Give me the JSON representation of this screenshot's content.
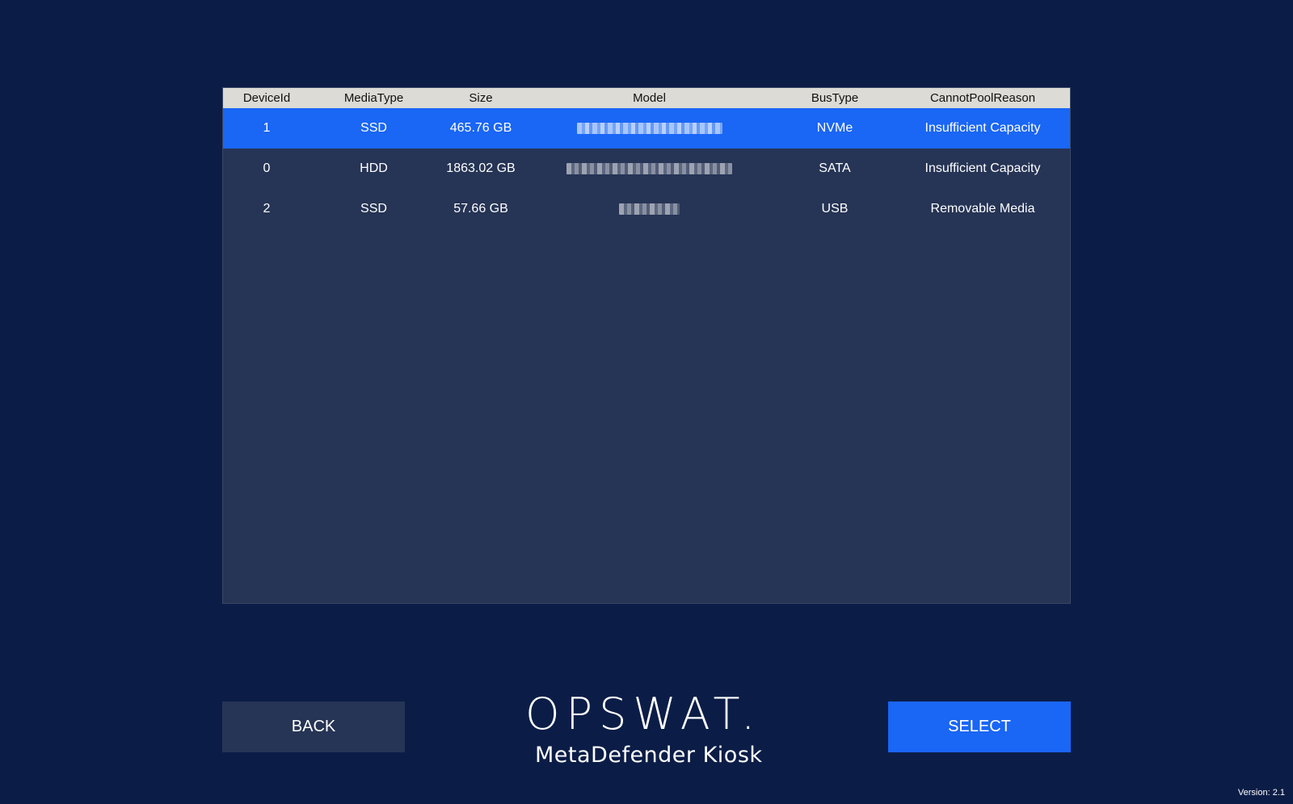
{
  "table": {
    "columns": [
      "DeviceId",
      "MediaType",
      "Size",
      "Model",
      "BusType",
      "CannotPoolReason"
    ],
    "rows": [
      {
        "device_id": "1",
        "media_type": "SSD",
        "size": "465.76 GB",
        "bus_type": "NVMe",
        "reason": "Insufficient Capacity",
        "selected": true
      },
      {
        "device_id": "0",
        "media_type": "HDD",
        "size": "1863.02 GB",
        "bus_type": "SATA",
        "reason": "Insufficient Capacity",
        "selected": false
      },
      {
        "device_id": "2",
        "media_type": "SSD",
        "size": "57.66 GB",
        "bus_type": "USB",
        "reason": "Removable Media",
        "selected": false
      }
    ]
  },
  "buttons": {
    "back_label": "BACK",
    "select_label": "SELECT"
  },
  "branding": {
    "logo": "OPSWAT.",
    "product": "MetaDefender Kiosk"
  },
  "footer": {
    "version": "Version: 2.1"
  },
  "colors": {
    "background": "#0b1d47",
    "panel": "#263455",
    "header": "#dcdbd5",
    "accent": "#1a66f5"
  }
}
